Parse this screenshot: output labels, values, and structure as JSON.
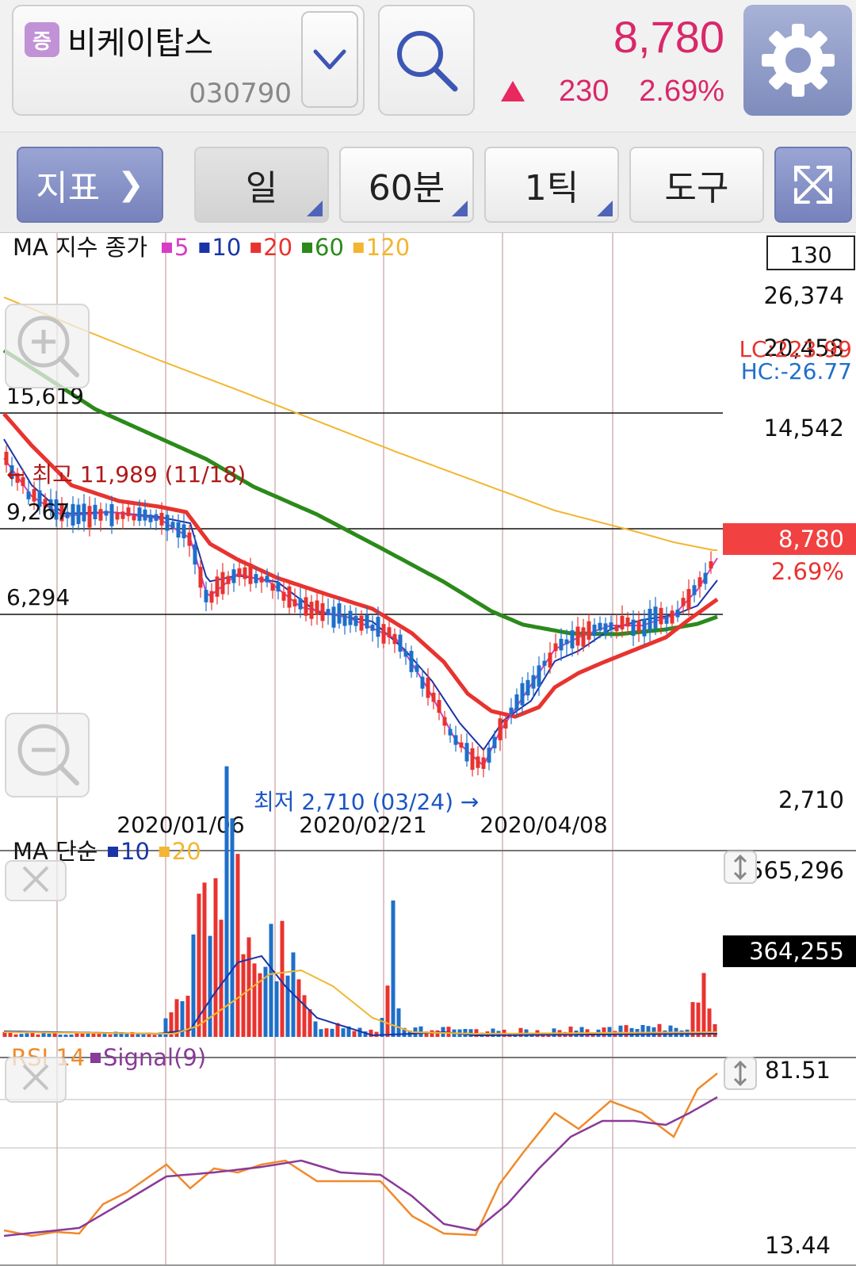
{
  "header": {
    "badge": "증",
    "stock_name": "비케이탑스",
    "stock_code": "030790",
    "price": "8,780",
    "change": "230",
    "change_pct": "2.69%"
  },
  "toolbar": {
    "indicator": "지표",
    "day": "일",
    "min60": "60분",
    "tick": "1틱",
    "tools": "도구"
  },
  "colors": {
    "up": "#e8332f",
    "down": "#1e6fc9",
    "ma5": "#d63cc6",
    "ma10": "#1a34a8",
    "ma20": "#e8332f",
    "ma60": "#2b8a1a",
    "ma120": "#f2b630",
    "rsi": "#f08a2c",
    "signal": "#8a3a98"
  },
  "chart_data": [
    {
      "type": "candlestick",
      "legend": {
        "title": "MA 지수 종가",
        "items": [
          {
            "label": "5",
            "color": "#d63cc6"
          },
          {
            "label": "10",
            "color": "#1a34a8"
          },
          {
            "label": "20",
            "color": "#e8332f"
          },
          {
            "label": "60",
            "color": "#2b8a1a"
          },
          {
            "label": "120",
            "color": "#f2b630"
          }
        ]
      },
      "count_box": "130",
      "yaxis_labels": [
        "26,374",
        "20,458",
        "14,542",
        "2,710"
      ],
      "left_labels": [
        "15,619",
        "9,267",
        "6,294"
      ],
      "horizontal_lines": [
        15619,
        9267,
        6294
      ],
      "lc_label": "LC:223.99",
      "hc_label": "HC:-26.77",
      "current_price": "8,780",
      "current_pct": "2.69%",
      "high_annotation": "← 최고 11,989 (11/18)",
      "low_annotation": "최저 2,710 (03/24) →",
      "x_labels": [
        "2020/01/06",
        "2020/02/21",
        "2020/04/08"
      ]
    },
    {
      "type": "bar",
      "legend": {
        "title": "MA 단순",
        "items": [
          {
            "label": "10",
            "color": "#1a34a8"
          },
          {
            "label": "20",
            "color": "#f2b630"
          }
        ]
      },
      "max_label": "7,565,296",
      "current_label": "364,255"
    },
    {
      "type": "line",
      "legend": {
        "items": [
          {
            "label": "RSI 14",
            "color": "#f08a2c"
          },
          {
            "label": "Signal(9)",
            "color": "#8a3a98"
          }
        ]
      },
      "max_label": "81.51",
      "min_label": "13.44"
    }
  ]
}
